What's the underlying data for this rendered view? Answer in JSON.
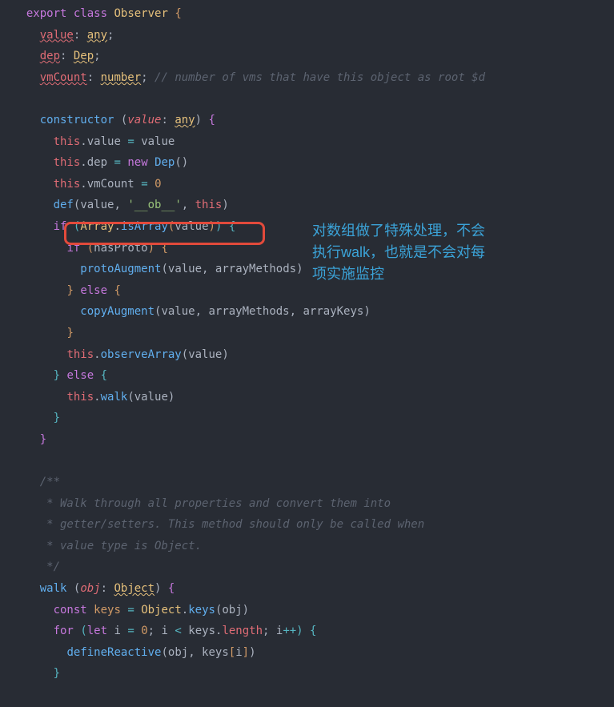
{
  "code": {
    "l1_export": "export",
    "l1_class": "class",
    "l1_name": "Observer",
    "l1_brace": "{",
    "l2_value": "value",
    "l2_any": "any",
    "l3_dep": "dep",
    "l3_Dep": "Dep",
    "l4_vmCount": "vmCount",
    "l4_number": "number",
    "l4_comment": "// number of vms that have this object as root $d",
    "l6_constructor": "constructor",
    "l6_value": "value",
    "l6_any": "any",
    "l7_this": "this",
    "l7_value": "value",
    "l7_eq": "=",
    "l7_value2": "value",
    "l8_this": "this",
    "l8_dep": "dep",
    "l8_new": "new",
    "l8_Dep": "Dep",
    "l9_this": "this",
    "l9_vmCount": "vmCount",
    "l9_zero": "0",
    "l10_def": "def",
    "l10_value": "value",
    "l10_ob": "'__ob__'",
    "l10_this": "this",
    "l11_if": "if",
    "l11_Array": "Array",
    "l11_isArray": "isArray",
    "l11_value": "value",
    "l12_if": "if",
    "l12_hasProto": "hasProto",
    "l13_protoAugment": "protoAugment",
    "l13_value": "value",
    "l13_arrayMethods": "arrayMethods",
    "l14_else": "else",
    "l15_copyAugment": "copyAugment",
    "l15_value": "value",
    "l15_arrayMethods": "arrayMethods",
    "l15_arrayKeys": "arrayKeys",
    "l17_this": "this",
    "l17_observeArray": "observeArray",
    "l17_value": "value",
    "l18_else": "else",
    "l19_this": "this",
    "l19_walk": "walk",
    "l19_value": "value",
    "c1": "/**",
    "c2": " * Walk through all properties and convert them into",
    "c3": " * getter/setters. This method should only be called when",
    "c4": " * value type is Object.",
    "c5": " */",
    "w_walk": "walk",
    "w_obj": "obj",
    "w_Object": "Object",
    "w_const": "const",
    "w_keys": "keys",
    "w_Object2": "Object",
    "w_keys2": "keys",
    "w_obj2": "obj",
    "w_for": "for",
    "w_let": "let",
    "w_i": "i",
    "w_zero": "0",
    "w_i2": "i",
    "w_keys3": "keys",
    "w_length": "length",
    "w_i3": "i",
    "w_defineReactive": "defineReactive",
    "w_obj3": "obj",
    "w_keys4": "keys",
    "w_i4": "i"
  },
  "annotation": {
    "line1": "对数组做了特殊处理，不会",
    "line2": "执行walk，也就是不会对每",
    "line3": "项实施监控"
  }
}
